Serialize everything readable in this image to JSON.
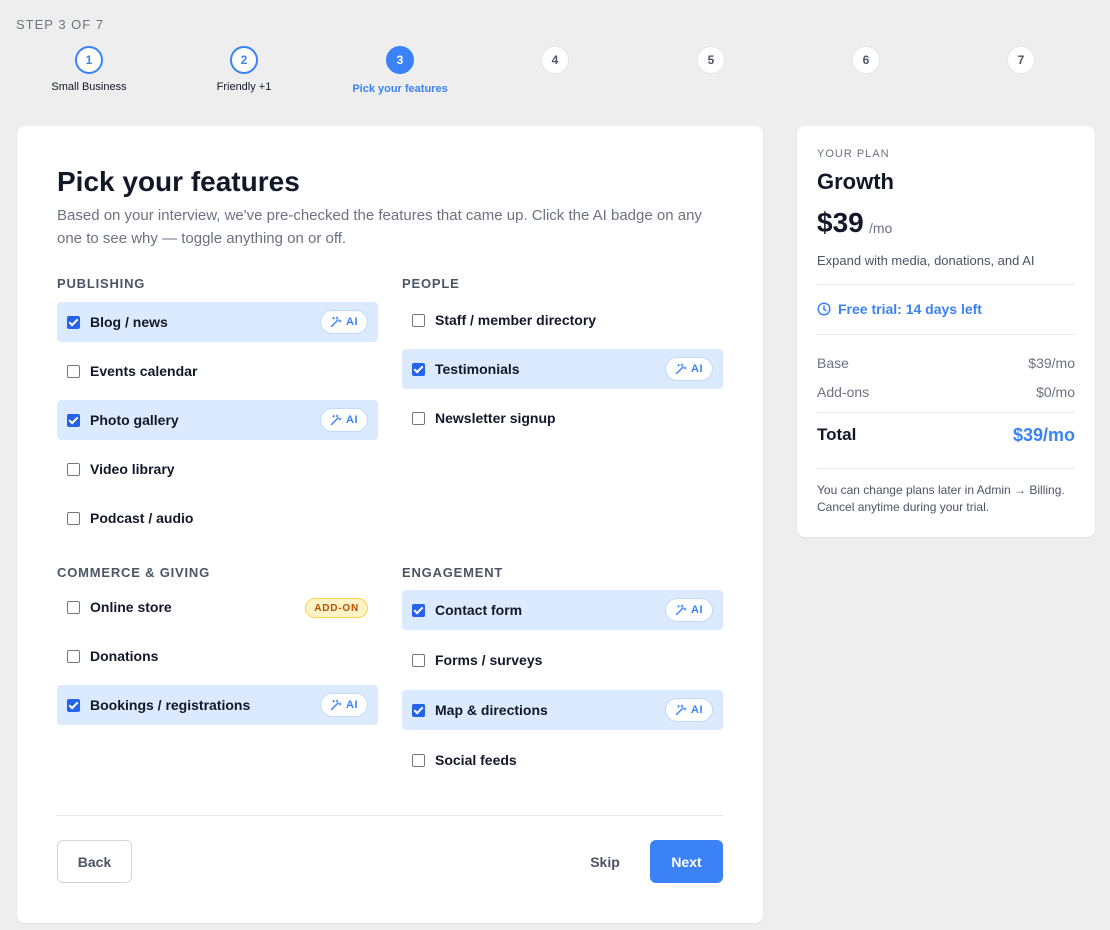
{
  "progress": {
    "counter": "STEP 3 OF 7"
  },
  "steps": [
    {
      "number": "1",
      "label": "Small Business",
      "state": "done"
    },
    {
      "number": "2",
      "label": "Friendly +1",
      "state": "done"
    },
    {
      "number": "3",
      "label": "Pick your features",
      "state": "current"
    },
    {
      "number": "4",
      "label": "",
      "state": "todo"
    },
    {
      "number": "5",
      "label": "",
      "state": "todo"
    },
    {
      "number": "6",
      "label": "",
      "state": "todo"
    },
    {
      "number": "7",
      "label": "",
      "state": "todo"
    }
  ],
  "main": {
    "title": "Pick your features",
    "intro": "Based on your interview, we've pre-checked the features that came up. Click the AI badge on any one to see why — toggle anything on or off.",
    "ai_badge_label": "AI",
    "addon_badge_label": "ADD-ON",
    "sections": {
      "publishing": {
        "title": "PUBLISHING",
        "items": [
          {
            "label": "Blog / news",
            "checked": true,
            "badge": "ai"
          },
          {
            "label": "Events calendar",
            "checked": false,
            "badge": ""
          },
          {
            "label": "Photo gallery",
            "checked": true,
            "badge": "ai"
          },
          {
            "label": "Video library",
            "checked": false,
            "badge": ""
          },
          {
            "label": "Podcast / audio",
            "checked": false,
            "badge": ""
          }
        ]
      },
      "people": {
        "title": "PEOPLE",
        "items": [
          {
            "label": "Staff / member directory",
            "checked": false,
            "badge": ""
          },
          {
            "label": "Testimonials",
            "checked": true,
            "badge": "ai"
          },
          {
            "label": "Newsletter signup",
            "checked": false,
            "badge": ""
          }
        ]
      },
      "commerce": {
        "title": "COMMERCE & GIVING",
        "items": [
          {
            "label": "Online store",
            "checked": false,
            "badge": "addon"
          },
          {
            "label": "Donations",
            "checked": false,
            "badge": ""
          },
          {
            "label": "Bookings / registrations",
            "checked": true,
            "badge": "ai"
          }
        ]
      },
      "engagement": {
        "title": "ENGAGEMENT",
        "items": [
          {
            "label": "Contact form",
            "checked": true,
            "badge": "ai"
          },
          {
            "label": "Forms / surveys",
            "checked": false,
            "badge": ""
          },
          {
            "label": "Map & directions",
            "checked": true,
            "badge": "ai"
          },
          {
            "label": "Social feeds",
            "checked": false,
            "badge": ""
          }
        ]
      }
    },
    "buttons": {
      "back": "Back",
      "skip": "Skip",
      "next": "Next"
    }
  },
  "plan": {
    "kicker": "YOUR PLAN",
    "name": "Growth",
    "price": "$39",
    "per": "/mo",
    "description": "Expand with media, donations, and AI",
    "trial": "Free trial: 14 days left",
    "base_label": "Base",
    "base_value": "$39/mo",
    "addons_label": "Add-ons",
    "addons_value": "$0/mo",
    "total_label": "Total",
    "total_value": "$39/mo",
    "note": "You can change plans later in Admin → Billing. Cancel anytime during your trial."
  },
  "colors": {
    "accent": "#3b82f6",
    "selected_row": "#dbeafe",
    "page_bg": "#eeeeee"
  },
  "icons": {
    "ai_badge": "magic-wand-icon",
    "trial": "clock-icon"
  }
}
